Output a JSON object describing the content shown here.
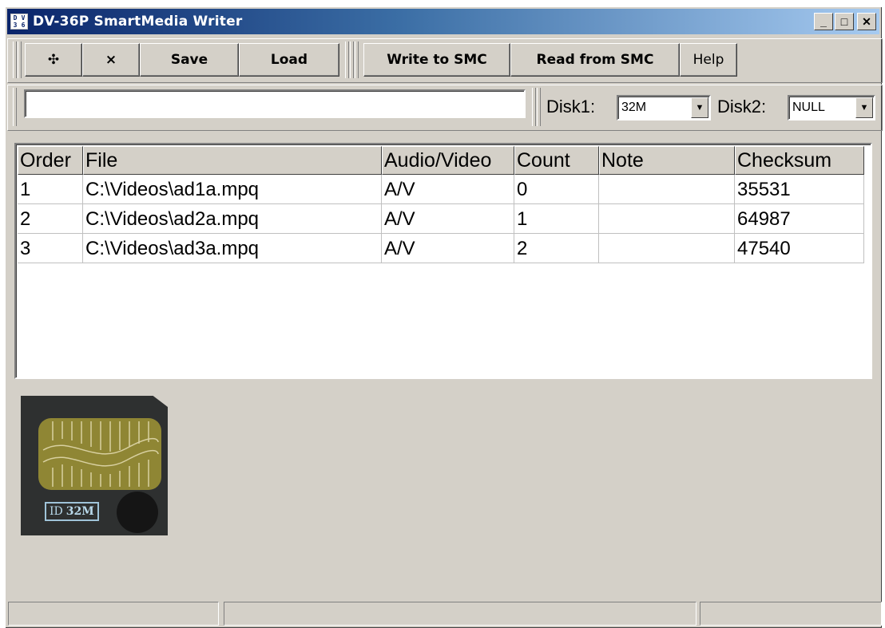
{
  "window": {
    "title": "DV-36P SmartMedia Writer",
    "icon_glyphs": [
      "D",
      "V",
      "3",
      "6"
    ]
  },
  "title_buttons": {
    "minimize": "_",
    "maximize": "□",
    "close": "✕"
  },
  "toolbar": {
    "add_label": "✣",
    "remove_label": "×",
    "save_label": "Save",
    "load_label": "Load",
    "write_label": "Write to SMC",
    "read_label": "Read from SMC",
    "help_label": "Help"
  },
  "path_input": {
    "value": ""
  },
  "disk1": {
    "label": "Disk1:",
    "value": "32M"
  },
  "disk2": {
    "label": "Disk2:",
    "value": "NULL"
  },
  "list": {
    "columns": [
      "Order",
      "File",
      "Audio/Video",
      "Count",
      "Note",
      "Checksum"
    ],
    "rows": [
      [
        "1",
        "C:\\Videos\\ad1a.mpq",
        "A/V",
        "0",
        "",
        "35531"
      ],
      [
        "2",
        "C:\\Videos\\ad2a.mpq",
        "A/V",
        "1",
        "",
        "64987"
      ],
      [
        "3",
        "C:\\Videos\\ad3a.mpq",
        "A/V",
        "2",
        "",
        "47540"
      ]
    ]
  },
  "card": {
    "badge_id": "ID",
    "badge_size": "32M"
  },
  "status": {
    "panel1": "",
    "panel2": "",
    "panel3": ""
  }
}
